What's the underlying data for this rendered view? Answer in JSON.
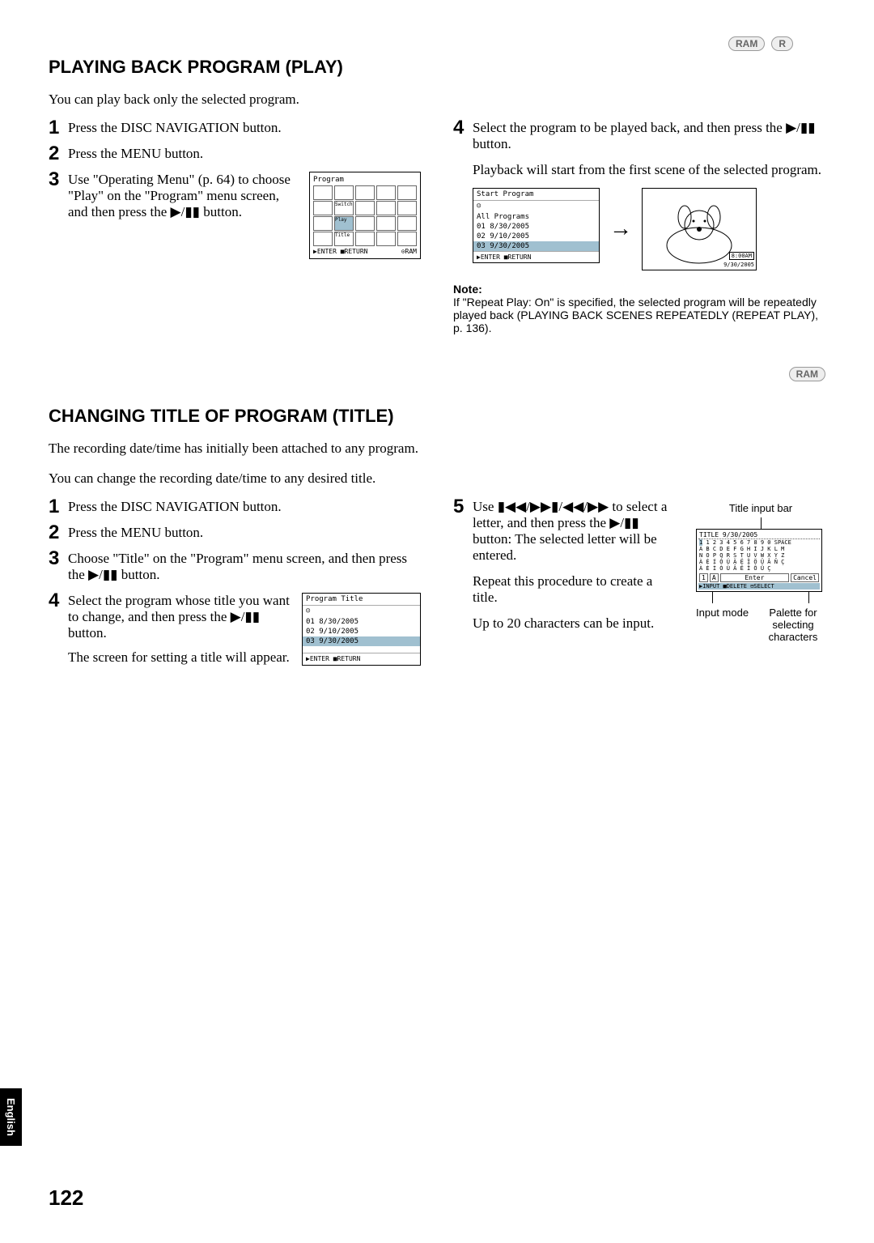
{
  "badges_top": {
    "ram": "RAM",
    "r": "R"
  },
  "play": {
    "heading": "PLAYING BACK PROGRAM (PLAY)",
    "intro": "You can play back only the selected program.",
    "step1": "Press the DISC NAVIGATION button.",
    "step2": "Press the MENU button.",
    "step3": "Use \"Operating Menu\" (p. 64) to choose \"Play\" on the \"Program\" menu screen, and then press the ▶/▮▮ button.",
    "step4a": "Select the program to be played back, and then press the ▶/▮▮ button.",
    "step4b": "Playback will start from the first scene of the selected program.",
    "screen3": {
      "title": "Program",
      "labels": [
        "Switch",
        "Play",
        "Title"
      ],
      "footer_enter": "▶ENTER",
      "footer_return": "■RETURN",
      "footer_ram": "⊙RAM"
    },
    "start_box": {
      "title": "Start Program",
      "all": "All Programs",
      "r1": "01  8/30/2005",
      "r2": "02  9/10/2005",
      "r3": "03  9/30/2005",
      "ftr": "▶ENTER ■RETURN"
    },
    "dog": {
      "time": "8:00AM",
      "date": "9/30/2005"
    },
    "note_label": "Note:",
    "note_body": "If \"Repeat Play: On\" is specified, the selected program will be repeatedly played back (PLAYING BACK SCENES REPEATEDLY (REPEAT PLAY), p. 136)."
  },
  "title_sec": {
    "badge": "RAM",
    "heading": "CHANGING TITLE OF PROGRAM (TITLE)",
    "intro1": "The recording date/time has initially been attached to any program.",
    "intro2": "You can change the recording date/time to any desired title.",
    "step1": "Press the DISC NAVIGATION button.",
    "step2": "Press the MENU button.",
    "step3": "Choose \"Title\" on the \"Program\" menu screen, and then press the ▶/▮▮ button.",
    "step4": "Select the program whose title you want to change, and then press the ▶/▮▮ button.",
    "step4b": "The screen for setting a title will appear.",
    "step5a": "Use ▮◀◀/▶▶▮/◀◀/▶▶ to select a letter, and then press the ▶/▮▮ button: The selected letter will be entered.",
    "step5b": "Repeat this procedure to create a title.",
    "step5c": "Up to 20 characters can be input.",
    "prog_title_screen": {
      "title": "Program Title",
      "r1": "01  8/30/2005",
      "r2": "02  9/10/2005",
      "r3": "03  9/30/2005",
      "ftr": "▶ENTER ■RETURN"
    },
    "annot_top": "Title input bar",
    "annot_mid": "Input mode",
    "annot_bot": "Palette for selecting characters",
    "kb": {
      "hdr": "TITLE 9/30/2005",
      "row1": "1 2 3 4 5 6 7 8 9 0 SPACE",
      "row2": "A B C D E F G H I J K L M",
      "row3": "N O P Q R S T U V W X Y Z",
      "row4": "À É Í Ó Ú Ä Ë Ï Ö Ü Â Ñ Ç",
      "row5": "À È Ì Ò Ù Â Ê Î Ô Û Ç",
      "enter": "Enter",
      "cancel": "Cancel",
      "ftr": "▶INPUT ■DELETE ⊟SELECT"
    }
  },
  "lang_tab": "English",
  "page_number": "122"
}
